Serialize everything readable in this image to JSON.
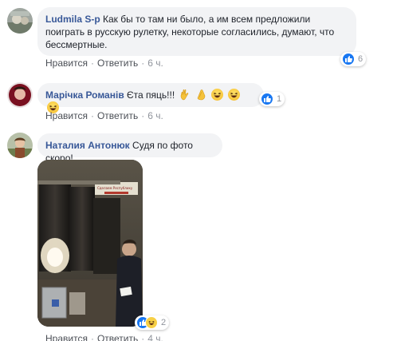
{
  "comments": [
    {
      "author": "Ludmila S-p",
      "text_line1": "Как бы то там ни было, а им всем предложили",
      "text_line2": "поиграть в русскую рулетку, некоторые согласились, думают, что",
      "text_line3": "бессмертные.",
      "like_label": "Нравится",
      "reply_label": "Ответить",
      "time": "6 ч.",
      "reaction_count": "6"
    },
    {
      "author": "Марічка Романів",
      "text": "Єта пяць!!!",
      "like_label": "Нравится",
      "reply_label": "Ответить",
      "time": "6 ч.",
      "reaction_count": "1"
    },
    {
      "author": "Наталия Антонюк",
      "text": "Судя по фото скоро!",
      "photo_banner_text": "Сделаем Республику",
      "like_label": "Нравится",
      "reply_label": "Ответить",
      "time": "4 ч.",
      "reaction_count": "2"
    }
  ],
  "colors": {
    "author": "#385898",
    "bubble": "#f2f3f5",
    "meta": "#90949c",
    "like_blue": "#1877f2",
    "haha_yellow": "#f7d046"
  },
  "icons": [
    "avatar",
    "like-reaction-icon",
    "haha-reaction-icon",
    "ok-hand-emoji",
    "clap-emoji",
    "laughing-emoji"
  ]
}
